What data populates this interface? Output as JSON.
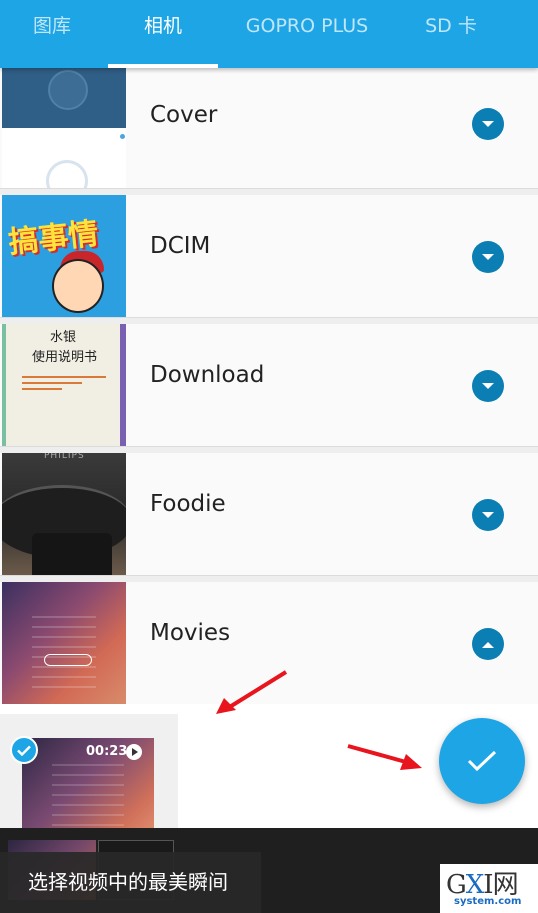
{
  "tabs": [
    {
      "label": "图库"
    },
    {
      "label": "相机"
    },
    {
      "label": "GOPRO PLUS"
    },
    {
      "label": "SD 卡"
    }
  ],
  "active_tab": "相机",
  "folders": [
    {
      "label": "Cover",
      "toggle_icon": "chevron-down-icon"
    },
    {
      "label": "DCIM",
      "toggle_icon": "chevron-down-icon"
    },
    {
      "label": "Download",
      "toggle_icon": "chevron-down-icon"
    },
    {
      "label": "Foodie",
      "toggle_icon": "chevron-down-icon"
    },
    {
      "label": "Movies",
      "toggle_icon": "chevron-up-icon"
    }
  ],
  "thumb_text": {
    "dcim_title": "搞事情",
    "download_title": "水银",
    "download_subtitle": "使用说明书",
    "foodie_brand": "PHILIPS"
  },
  "selected_video": {
    "duration": "00:23",
    "selected": true
  },
  "toast": "选择视频中的最美瞬间",
  "watermark": {
    "main": "GXI网",
    "sub": "system.com"
  },
  "colors": {
    "accent": "#1ea5e6",
    "toggle": "#0b7fb3",
    "annotation": "#e8141e"
  }
}
